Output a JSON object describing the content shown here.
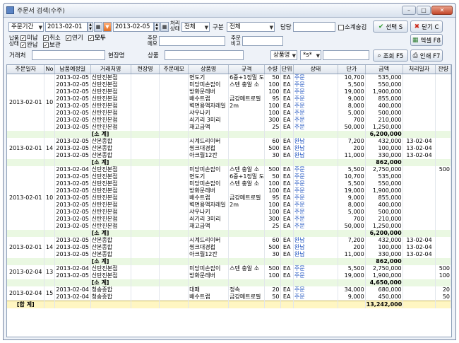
{
  "window": {
    "title": "주문서 검색(수주)",
    "minimize": "–",
    "maximize": "□",
    "close": "✕"
  },
  "filter": {
    "period_type": "주문기간",
    "date_from": "2013-02-01",
    "date_to": "2013-02-05",
    "process_status_label": "처리상태",
    "process_status_value": "전체",
    "category_label": "구분",
    "category_value": "전체",
    "person_label": "담당",
    "person_value": "",
    "subtotal_hide_label": "소계숨김",
    "select_button": "선택 S",
    "close_button": "닫기 C",
    "delivery_status_label": "납품상태",
    "checkboxes": [
      {
        "label": "미납",
        "checked": true
      },
      {
        "label": "취소",
        "checked": true
      },
      {
        "label": "연기",
        "checked": true
      },
      {
        "label": "모두",
        "checked": true
      },
      {
        "label": "완납",
        "checked": true
      },
      {
        "label": "보관",
        "checked": true
      }
    ],
    "order_memo_label": "주문메모",
    "order_memo_value": "",
    "order_remark_label": "주문비고",
    "order_remark_value": "",
    "excel_button": "엑셀 F8",
    "client_label": "거래처",
    "client_value": "",
    "site_label": "현장명",
    "product_label": "상품",
    "product_value": "",
    "product_field_select": "상품명",
    "product_op_select": "*s*",
    "search_button": "조회 F5",
    "print_button": "인쇄 F7"
  },
  "columns": [
    "주문일자",
    "No",
    "납품예정일",
    "거래처명",
    "현장명",
    "주문메모",
    "상품명",
    "규격",
    "수량",
    "단위",
    "상태",
    "단가",
    "금액",
    "처리일자",
    "잔량"
  ],
  "groups": [
    {
      "date": "2013-02-01",
      "no": "10",
      "rows": [
        [
          "2013-02-05",
          "신탄진본점",
          "",
          "",
          "면도기",
          "6중+1정밀 도",
          "50",
          "EA",
          "주문",
          "10,700",
          "535,000",
          "",
          ""
        ],
        [
          "2013-02-05",
          "신탄진본점",
          "",
          "",
          "미당미손잡이",
          "스텐 충알 소",
          "100",
          "EA",
          "주문",
          "5,500",
          "550,000",
          "",
          ""
        ],
        [
          "2013-02-05",
          "신탄진본점",
          "",
          "",
          "방화문레버",
          "",
          "100",
          "EA",
          "주문",
          "19,000",
          "1,900,000",
          "",
          ""
        ],
        [
          "2013-02-05",
          "신탄진본점",
          "",
          "",
          "배수트랩",
          "금강메트로필",
          "95",
          "EA",
          "주문",
          "9,000",
          "855,000",
          "",
          ""
        ],
        [
          "2013-02-05",
          "신탄진본점",
          "",
          "",
          "벽면용액자레일",
          "2m",
          "100",
          "EA",
          "주문",
          "8,000",
          "400,000",
          "",
          ""
        ],
        [
          "2013-02-05",
          "신탄진본점",
          "",
          "",
          "샤우나키",
          "",
          "100",
          "EA",
          "주문",
          "5,000",
          "500,000",
          "",
          ""
        ],
        [
          "2013-02-05",
          "신탄진본점",
          "",
          "",
          "쇠기리 3미리",
          "",
          "300",
          "EA",
          "주문",
          "700",
          "210,000",
          "",
          ""
        ],
        [
          "2013-02-05",
          "신탄진본점",
          "",
          "",
          "재고금액",
          "",
          "25",
          "EA",
          "주문",
          "50,000",
          "1,250,000",
          "",
          ""
        ]
      ],
      "subtotal": "6,200,000"
    },
    {
      "date": "2013-02-01",
      "no": "14",
      "rows": [
        [
          "2013-02-05",
          "산본종합",
          "",
          "",
          "시계드리이버",
          "",
          "60",
          "EA",
          "완납",
          "7,200",
          "432,000",
          "13-02-04",
          ""
        ],
        [
          "2013-02-05",
          "산본종합",
          "",
          "",
          "씽크대경첩",
          "",
          "500",
          "EA",
          "완납",
          "200",
          "100,000",
          "13-02-04",
          ""
        ],
        [
          "2013-02-05",
          "산본종합",
          "",
          "",
          "아크릴12칸",
          "",
          "30",
          "EA",
          "완납",
          "11,000",
          "330,000",
          "13-02-04",
          ""
        ]
      ],
      "subtotal": "862,000"
    },
    {
      "date": "2013-02-01",
      "no": "10",
      "rows": [
        [
          "2013-02-04",
          "신탄진본점",
          "",
          "",
          "미당미손잡이",
          "스텐 충알 소",
          "500",
          "EA",
          "주문",
          "5,500",
          "2,750,000",
          "",
          "500"
        ],
        [
          "2013-02-05",
          "신탄진본점",
          "",
          "",
          "면도기",
          "6중+1정밀 도",
          "50",
          "EA",
          "주문",
          "10,700",
          "535,000",
          "",
          ""
        ],
        [
          "2013-02-05",
          "신탄진본점",
          "",
          "",
          "미당미손잡이",
          "스텐 충알 소",
          "100",
          "EA",
          "주문",
          "5,500",
          "550,000",
          "",
          ""
        ],
        [
          "2013-02-05",
          "신탄진본점",
          "",
          "",
          "방화문레버",
          "",
          "100",
          "EA",
          "주문",
          "19,000",
          "1,900,000",
          "",
          ""
        ],
        [
          "2013-02-05",
          "신탄진본점",
          "",
          "",
          "배수트랩",
          "금강메트로필",
          "95",
          "EA",
          "주문",
          "9,000",
          "855,000",
          "",
          ""
        ],
        [
          "2013-02-05",
          "신탄진본점",
          "",
          "",
          "벽면용액자레일",
          "2m",
          "100",
          "EA",
          "주문",
          "8,000",
          "400,000",
          "",
          ""
        ],
        [
          "2013-02-05",
          "신탄진본점",
          "",
          "",
          "샤우나키",
          "",
          "100",
          "EA",
          "주문",
          "5,000",
          "500,000",
          "",
          ""
        ],
        [
          "2013-02-05",
          "신탄진본점",
          "",
          "",
          "쇠기리 3미리",
          "",
          "300",
          "EA",
          "주문",
          "700",
          "210,000",
          "",
          ""
        ],
        [
          "2013-02-05",
          "신탄진본점",
          "",
          "",
          "재고금액",
          "",
          "25",
          "EA",
          "주문",
          "50,000",
          "1,250,000",
          "",
          ""
        ]
      ],
      "subtotal": "6,200,000"
    },
    {
      "date": "2013-02-01",
      "no": "14",
      "rows": [
        [
          "2013-02-05",
          "산본종합",
          "",
          "",
          "시계드리이버",
          "",
          "60",
          "EA",
          "완납",
          "7,200",
          "432,000",
          "13-02-04",
          ""
        ],
        [
          "2013-02-05",
          "산본종합",
          "",
          "",
          "씽크대경첩",
          "",
          "500",
          "EA",
          "완납",
          "200",
          "100,000",
          "13-02-04",
          ""
        ],
        [
          "2013-02-05",
          "산본종합",
          "",
          "",
          "아크릴12칸",
          "",
          "30",
          "EA",
          "완납",
          "11,000",
          "330,000",
          "13-02-04",
          ""
        ]
      ],
      "subtotal": "862,000"
    },
    {
      "date": "2013-02-04",
      "no": "13",
      "rows": [
        [
          "2013-02-04",
          "신탄진본점",
          "",
          "",
          "미당미손잡이",
          "스텐 충알 소",
          "500",
          "EA",
          "주문",
          "5,500",
          "2,750,000",
          "",
          "500"
        ],
        [
          "2013-02-05",
          "신탄진본점",
          "",
          "",
          "방화문레버",
          "",
          "100",
          "EA",
          "주문",
          "19,000",
          "1,900,000",
          "",
          "100"
        ]
      ],
      "subtotal": "4,650,000"
    },
    {
      "date": "2013-02-04",
      "no": "15",
      "rows": [
        [
          "2013-02-04",
          "청송종합",
          "",
          "",
          "대패",
          "정속",
          "20",
          "EA",
          "주문",
          "34,000",
          "680,000",
          "",
          "20"
        ],
        [
          "2013-02-04",
          "청송종합",
          "",
          "",
          "배수트랩",
          "금강메트로필",
          "50",
          "EA",
          "주문",
          "9,000",
          "450,000",
          "",
          "50"
        ]
      ],
      "subtotal": null
    }
  ],
  "subtotal_label": "[소 계]",
  "grand_total_label": "[합 계]",
  "grand_total": "13,242,000",
  "colors": {
    "accent": "#1a4fbf",
    "subtotal_bg": "#eaf8e2",
    "total_bg": "#fff6c2"
  }
}
